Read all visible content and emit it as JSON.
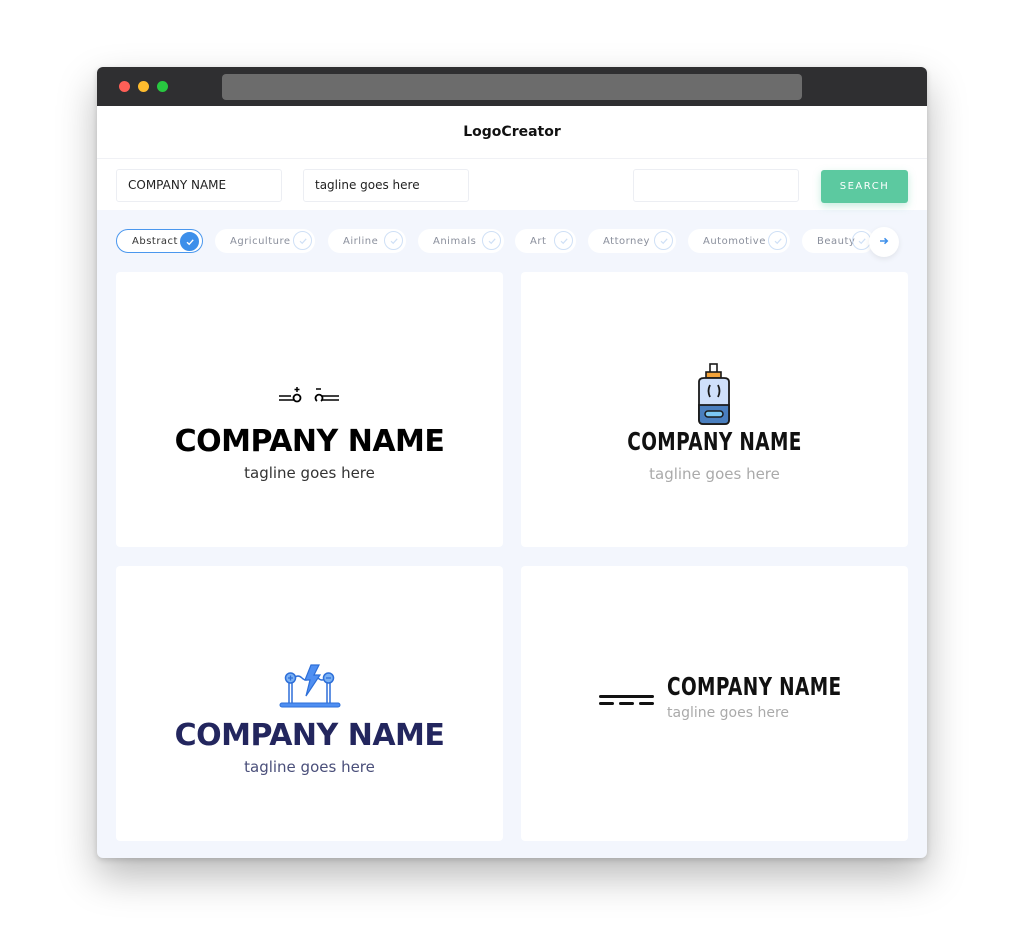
{
  "app": {
    "title": "LogoCreator"
  },
  "toolbar": {
    "company_value": "COMPANY NAME",
    "tagline_value": "tagline goes here",
    "search_value": "",
    "search_label": "SEARCH",
    "accent_color": "#5cc9a0"
  },
  "categories": {
    "items": [
      {
        "label": "Abstract",
        "selected": true
      },
      {
        "label": "Agriculture",
        "selected": false
      },
      {
        "label": "Airline",
        "selected": false
      },
      {
        "label": "Animals",
        "selected": false
      },
      {
        "label": "Art",
        "selected": false
      },
      {
        "label": "Attorney",
        "selected": false
      },
      {
        "label": "Automotive",
        "selected": false
      },
      {
        "label": "Beauty",
        "selected": false
      }
    ],
    "next_icon": "arrow-right-icon",
    "selected_color": "#3d8fea"
  },
  "logos": [
    {
      "icon": "electric-terminals-icon",
      "company": "COMPANY NAME",
      "tagline": "tagline goes here",
      "name_color": "#000000",
      "tagline_color": "#333333"
    },
    {
      "icon": "battery-meter-icon",
      "company": "COMPANY NAME",
      "tagline": "tagline goes here",
      "name_color": "#111111",
      "tagline_color": "#aaaaaa"
    },
    {
      "icon": "electric-circuit-lightning-icon",
      "company": "COMPANY NAME",
      "tagline": "tagline goes here",
      "name_color": "#23265e",
      "tagline_color": "#4a4f7a"
    },
    {
      "icon": "direct-current-symbol-icon",
      "company": "COMPANY NAME",
      "tagline": "tagline goes here",
      "name_color": "#111111",
      "tagline_color": "#aaaaaa"
    }
  ]
}
